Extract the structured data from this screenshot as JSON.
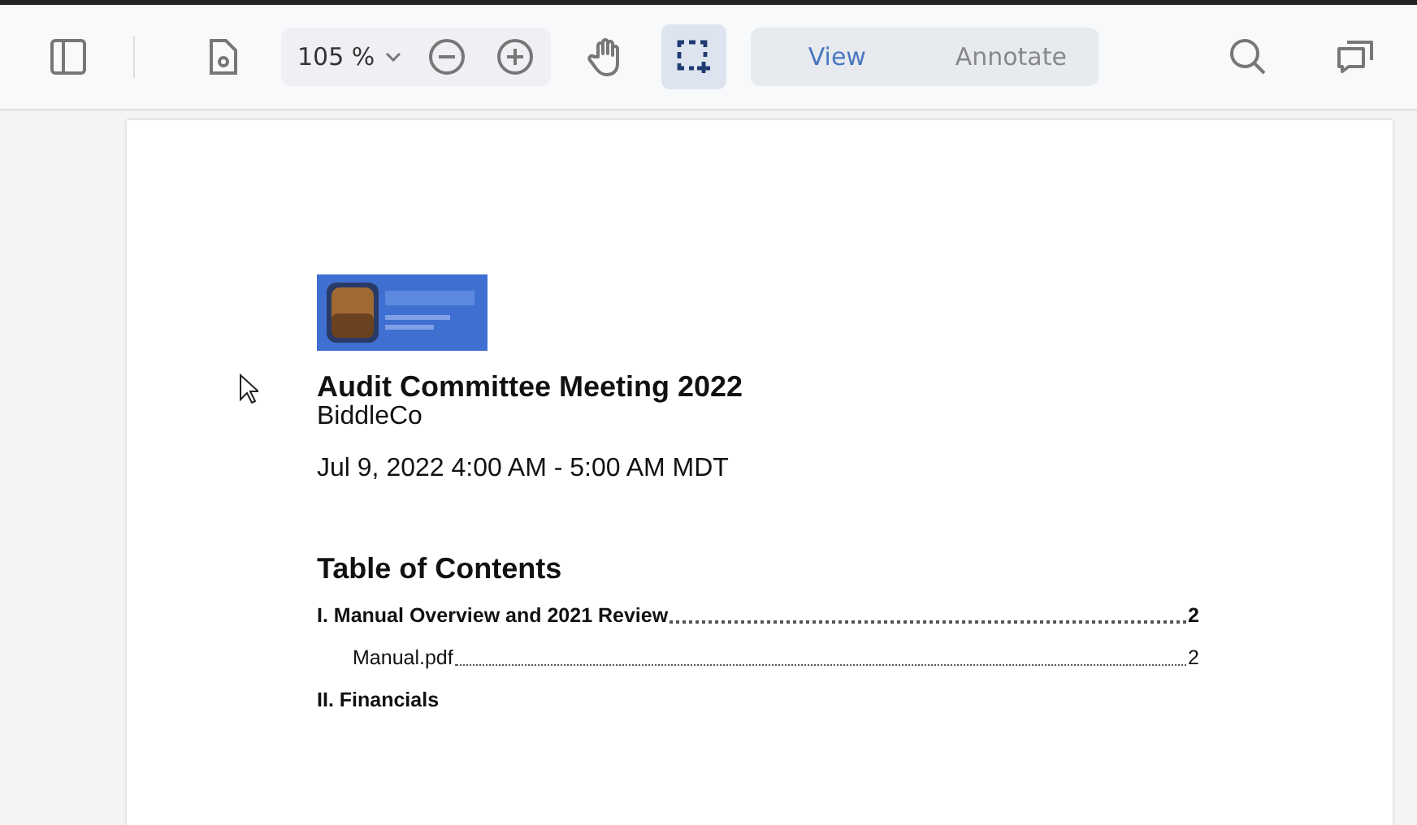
{
  "toolbar": {
    "zoom": "105 %",
    "tools": [
      {
        "kind": "hand",
        "selected": false
      },
      {
        "kind": "select",
        "selected": true
      }
    ],
    "modes": [
      {
        "label": "View",
        "selected": true
      },
      {
        "label": "Annotate",
        "selected": false
      }
    ]
  },
  "document": {
    "title": "Audit Committee Meeting 2022",
    "organization": "BiddleCo",
    "date": "Jul 9, 2022 4:00 AM - 5:00 AM MDT",
    "toc": {
      "heading": "Table of Contents",
      "entries": [
        {
          "title": "I. Manual Overview and 2021 Review",
          "page": "2",
          "children": [
            {
              "title": "Manual.pdf",
              "page": "2"
            }
          ]
        },
        {
          "title": "II. Financials"
        }
      ]
    }
  }
}
